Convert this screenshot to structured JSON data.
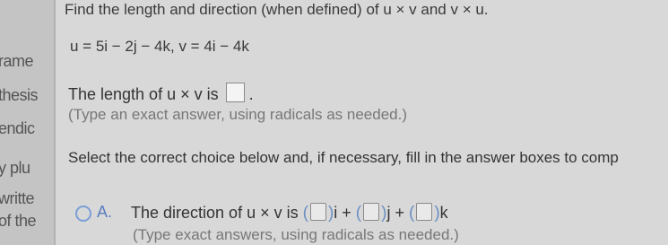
{
  "sidebar": {
    "fragments": [
      "rame",
      "thesis",
      "endic",
      "y plu",
      "writte",
      "of the"
    ]
  },
  "problem": {
    "title": "Find the length and direction (when defined) of u × v and v × u.",
    "vectors": "u = 5i − 2j − 4k,   v = 4i − 4k"
  },
  "length_question": {
    "prompt": "The length of u × v is",
    "answer_value": "",
    "suffix": ".",
    "hint": "(Type an exact answer, using radicals as needed.)"
  },
  "choice": {
    "instruction": "Select the correct choice below and, if necessary, fill in the answer boxes to comp",
    "option_a": {
      "letter": "A.",
      "text": "The direction of u × v is",
      "i_label": "i +",
      "j_label": "j +",
      "k_label": "k",
      "hint": "(Type exact answers, using radicals as needed.)"
    }
  },
  "colors": {
    "accent": "#6a8fc2",
    "background": "#d8d8d8"
  }
}
